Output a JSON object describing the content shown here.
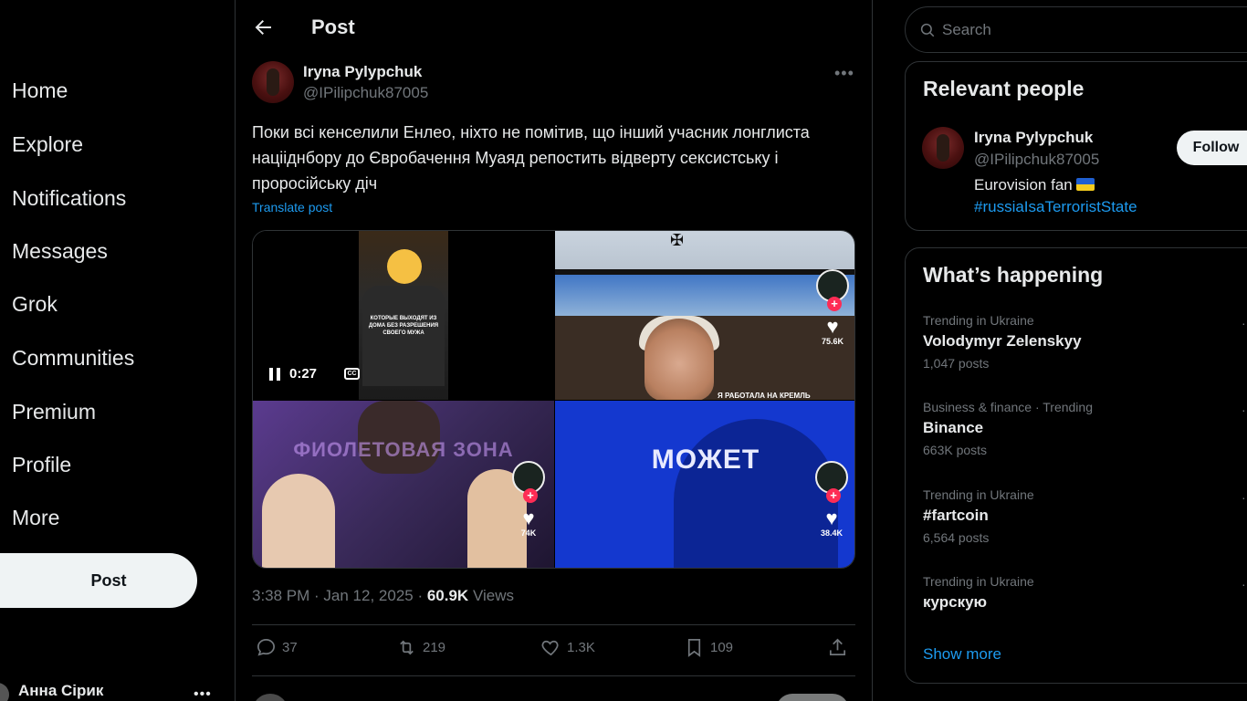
{
  "nav": {
    "items": [
      {
        "label": "Home"
      },
      {
        "label": "Explore"
      },
      {
        "label": "Notifications"
      },
      {
        "label": "Messages"
      },
      {
        "label": "Grok"
      },
      {
        "label": "Communities"
      },
      {
        "label": "Premium"
      },
      {
        "label": "Profile"
      },
      {
        "label": "More"
      }
    ],
    "post_label": "Post",
    "account_name": "Анна Сірик"
  },
  "header": {
    "title": "Post"
  },
  "post": {
    "author_name": "Iryna Pylypchuk",
    "author_handle": "@IPilipchuk87005",
    "text": "Поки всі кенселили Енлео, ніхто не помітив, що інший учасник лонглиста націіднбору до Євробачення Муаяд репостить відверту сексистську і проросійську діч",
    "translate_label": "Translate post",
    "media": {
      "video_time": "0:27",
      "cc_label": "CC",
      "frame1_caption": "КОТОРЫЕ ВЫХОДЯТ ИЗ ДОМА БЕЗ РАЗРЕШЕНИЯ СВОЕГО МУЖА",
      "frame2_like_count": "75.6K",
      "frame2_subtitle": "Я РАБОТАЛА НА КРЕМЛЬ",
      "frame3_overlay": "ФИОЛЕТОВАЯ ЗОНА",
      "frame3_like_count": "74K",
      "frame4_word": "МОЖЕТ",
      "frame4_like_count": "38.4K"
    },
    "time": "3:38 PM",
    "date": "Jan 12, 2025",
    "views_count": "60.9K",
    "views_label": "Views",
    "replies": "37",
    "reposts": "219",
    "likes": "1.3K",
    "bookmarks": "109"
  },
  "search": {
    "placeholder": "Search"
  },
  "relevant_people": {
    "title": "Relevant people",
    "name": "Iryna Pylypchuk",
    "handle": "@IPilipchuk87005",
    "bio": "Eurovision fan",
    "hashtag": "#russiaIsaTerroristState",
    "follow_label": "Follow"
  },
  "whats_happening": {
    "title": "What’s happening",
    "trends": [
      {
        "context": "Trending in Ukraine",
        "name": "Volodymyr Zelenskyy",
        "count": "1,047 posts"
      },
      {
        "context": "Business & finance · Trending",
        "name": "Binance",
        "count": "663K posts"
      },
      {
        "context": "Trending in Ukraine",
        "name": "#fartcoin",
        "count": "6,564 posts"
      },
      {
        "context": "Trending in Ukraine",
        "name": "курскую",
        "count": ""
      }
    ],
    "show_more": "Show more"
  },
  "colors": {
    "accent": "#1d9bf0",
    "background": "#000000",
    "border": "#2f3336",
    "muted": "#71767b"
  }
}
